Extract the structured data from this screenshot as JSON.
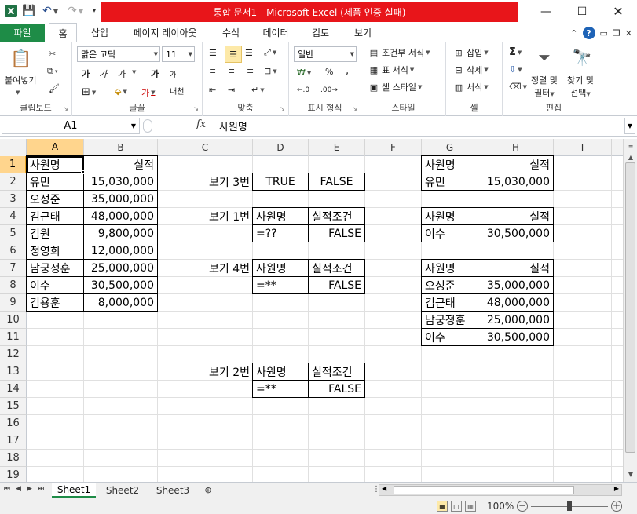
{
  "title_bar": {
    "title": "통합 문서1  -  Microsoft Excel (제품 인증 실패)",
    "app_icon": "X",
    "minimize_glyph": "—",
    "maximize_glyph": "☐",
    "close_glyph": "✕"
  },
  "ribbon_tabs": [
    {
      "label": "파일"
    },
    {
      "label": "홈"
    },
    {
      "label": "삽입"
    },
    {
      "label": "페이지 레이아웃"
    },
    {
      "label": "수식"
    },
    {
      "label": "데이터"
    },
    {
      "label": "검토"
    },
    {
      "label": "보기"
    }
  ],
  "ribbon": {
    "clipboard": {
      "paste_label": "붙여넣기",
      "group_label": "클립보드"
    },
    "font": {
      "font_name": "맑은 고딕",
      "font_size": "11",
      "bold": "가",
      "italic": "가",
      "underline": "가",
      "grow": "가",
      "shrink": "가",
      "phonetic": "내천",
      "font_color_glyph": "가",
      "group_label": "글꼴"
    },
    "alignment": {
      "group_label": "맞춤"
    },
    "number": {
      "format": "일반",
      "percent": "%",
      "comma": ",",
      "group_label": "표시 형식"
    },
    "styles": {
      "conditional": "조건부 서식",
      "table": "표 서식",
      "cell_styles": "셀 스타일",
      "group_label": "스타일"
    },
    "cells": {
      "insert": "삽입",
      "delete": "삭제",
      "format": "서식",
      "group_label": "셀"
    },
    "editing": {
      "sort_filter_1": "정렬 및",
      "sort_filter_2": "필터",
      "find_1": "찾기 및",
      "find_2": "선택",
      "sigma": "Σ",
      "group_label": "편집"
    }
  },
  "formula_bar": {
    "name_box": "A1",
    "fx": "fx",
    "content": "사원명"
  },
  "columns": [
    "A",
    "B",
    "C",
    "D",
    "E",
    "F",
    "G",
    "H",
    "I"
  ],
  "rows": [
    "1",
    "2",
    "3",
    "4",
    "5",
    "6",
    "7",
    "8",
    "9",
    "10",
    "11",
    "12",
    "13",
    "14",
    "15",
    "16",
    "17",
    "18",
    "19"
  ],
  "cells": {
    "A1": "사원명",
    "B1": "실적",
    "A2": "유민",
    "B2": "15,030,000",
    "A3": "오성준",
    "B3": "35,000,000",
    "A4": "김근태",
    "B4": "48,000,000",
    "A5": "김원",
    "B5": "9,800,000",
    "A6": "정영희",
    "B6": "12,000,000",
    "A7": "남궁정훈",
    "B7": "25,000,000",
    "A8": "이수",
    "B8": "30,500,000",
    "A9": "김용훈",
    "B9": "8,000,000",
    "C2": "보기 3번",
    "D2": "TRUE",
    "E2": "FALSE",
    "C4": "보기 1번",
    "D4": "사원명",
    "E4": "실적조건",
    "D5": "=??",
    "E5": "FALSE",
    "C7": "보기 4번",
    "D7": "사원명",
    "E7": "실적조건",
    "D8": "=**",
    "E8": "FALSE",
    "C13": "보기 2번",
    "D13": "사원명",
    "E13": "실적조건",
    "D14": "=**",
    "E14": "FALSE",
    "G1": "사원명",
    "H1": "실적",
    "G2": "유민",
    "H2": "15,030,000",
    "G4": "사원명",
    "H4": "실적",
    "G5": "이수",
    "H5": "30,500,000",
    "G7": "사원명",
    "H7": "실적",
    "G8": "오성준",
    "H8": "35,000,000",
    "G9": "김근태",
    "H9": "48,000,000",
    "G10": "남궁정훈",
    "H10": "25,000,000",
    "G11": "이수",
    "H11": "30,500,000"
  },
  "sheet_tabs": [
    {
      "label": "Sheet1",
      "active": true
    },
    {
      "label": "Sheet2",
      "active": false
    },
    {
      "label": "Sheet3",
      "active": false
    }
  ],
  "status_bar": {
    "zoom": "100%",
    "zoom_level": 1.0
  },
  "colors": {
    "title_red": "#e8151a",
    "file_tab_green": "#1e8c47",
    "selection_header": "#ffd58d"
  }
}
